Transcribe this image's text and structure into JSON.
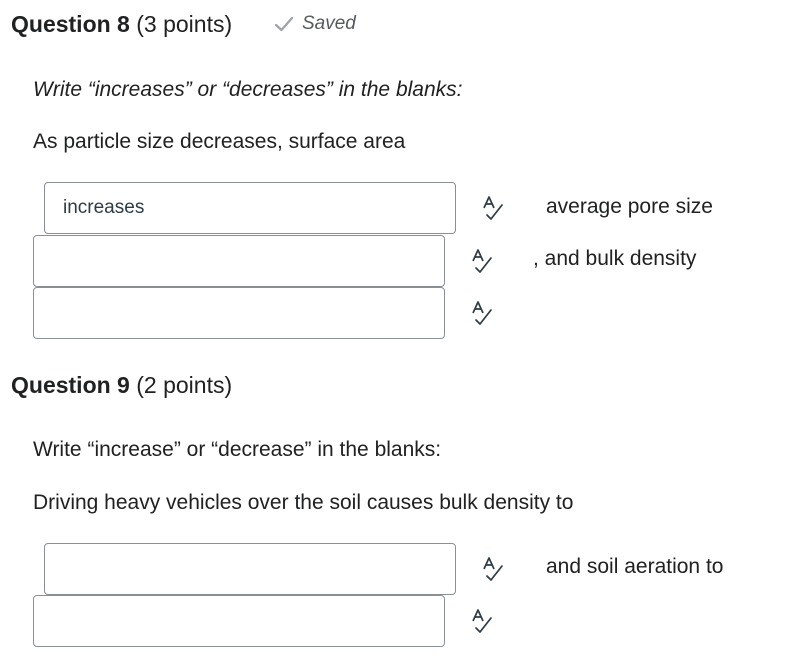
{
  "q8": {
    "title": "Question 8",
    "points": "(3 points)",
    "saved_label": "Saved",
    "instruction": "Write “increases” or “decreases” in the blanks:",
    "sentence": "As particle size decreases, surface area",
    "blanks": [
      {
        "value": "increases",
        "after_text": "average pore size"
      },
      {
        "value": "",
        "after_text": ", and bulk density"
      },
      {
        "value": "",
        "after_text": ""
      }
    ]
  },
  "q9": {
    "title": "Question 9",
    "points": "(2 points)",
    "instruction": "Write “increase” or “decrease” in the blanks:",
    "sentence": "Driving heavy vehicles over the soil causes bulk density to",
    "blanks": [
      {
        "value": "",
        "after_text": "and soil aeration to"
      },
      {
        "value": "",
        "after_text": ""
      }
    ]
  },
  "icons": {
    "saved": "checkmark-icon",
    "spellcheck": "spellcheck-icon"
  },
  "colors": {
    "text": "#202122",
    "muted": "#565a5c",
    "check": "#9ea3a6",
    "border": "#8a8f93"
  }
}
